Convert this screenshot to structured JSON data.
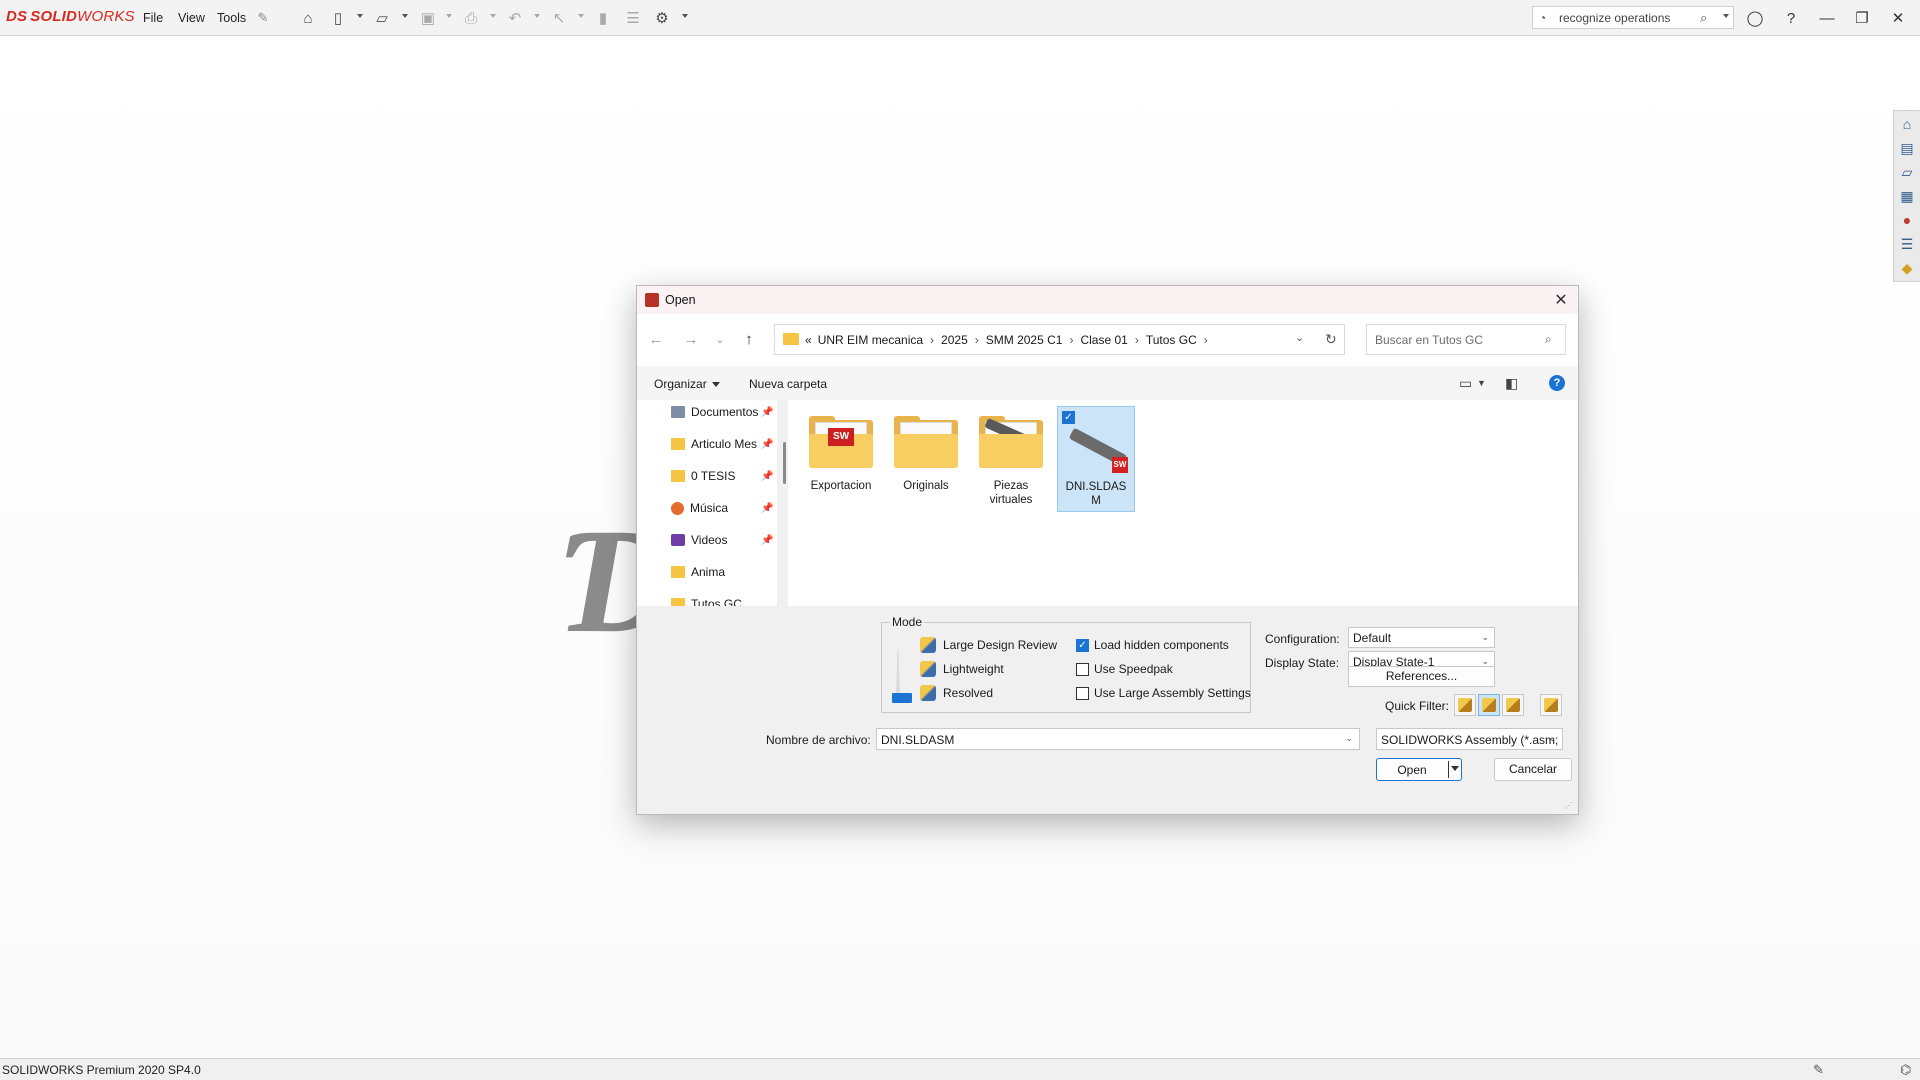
{
  "app": {
    "logo_prefix": "DS",
    "logo_solid": "SOLID",
    "logo_works": "WORKS",
    "menu": [
      "File",
      "View",
      "Tools"
    ],
    "search_placeholder": "recognize operations",
    "status_text": "SOLIDWORKS Premium 2020 SP4.0",
    "accent_color": "#d52b1e"
  },
  "dialog": {
    "title": "Open",
    "breadcrumb_prefix": "«",
    "breadcrumb": [
      "UNR EIM mecanica",
      "2025",
      "SMM 2025 C1",
      "Clase 01",
      "Tutos GC"
    ],
    "search_placeholder": "Buscar en Tutos GC",
    "toolbar": {
      "organize": "Organizar",
      "new_folder": "Nueva carpeta"
    },
    "nav_items": [
      {
        "label": "Documentos",
        "icon": "documents-icon",
        "pinned": true
      },
      {
        "label": "Articulo Mes",
        "icon": "folder-icon",
        "pinned": true
      },
      {
        "label": "0 TESIS",
        "icon": "folder-icon",
        "pinned": true
      },
      {
        "label": "Música",
        "icon": "music-icon",
        "pinned": true
      },
      {
        "label": "Videos",
        "icon": "videos-icon",
        "pinned": true
      },
      {
        "label": "Anima",
        "icon": "folder-icon",
        "pinned": false
      },
      {
        "label": "Tutos GC",
        "icon": "folder-icon",
        "pinned": false
      }
    ],
    "files": [
      {
        "name": "Exportacion",
        "type": "folder"
      },
      {
        "name": "Originals",
        "type": "folder"
      },
      {
        "name": "Piezas virtuales",
        "type": "folder"
      },
      {
        "name": "DNI.SLDASM",
        "type": "assembly",
        "selected": true
      }
    ],
    "mode": {
      "legend": "Mode",
      "options": [
        "Large Design Review",
        "Lightweight",
        "Resolved"
      ],
      "selected": "Resolved"
    },
    "checkboxes": [
      {
        "label": "Load hidden components",
        "checked": true
      },
      {
        "label": "Use Speedpak",
        "checked": false
      },
      {
        "label": "Use Large Assembly Settings",
        "checked": false
      }
    ],
    "configuration_label": "Configuration:",
    "configuration_value": "Default",
    "display_state_label": "Display State:",
    "display_state_value": "Display State-1",
    "references_label": "References...",
    "quick_filter_label": "Quick Filter:",
    "filename_label": "Nombre de archivo:",
    "filename_value": "DNI.SLDASM",
    "filetype_value": "SOLIDWORKS Assembly (*.asm;",
    "open_label": "Open",
    "cancel_label": "Cancelar"
  }
}
